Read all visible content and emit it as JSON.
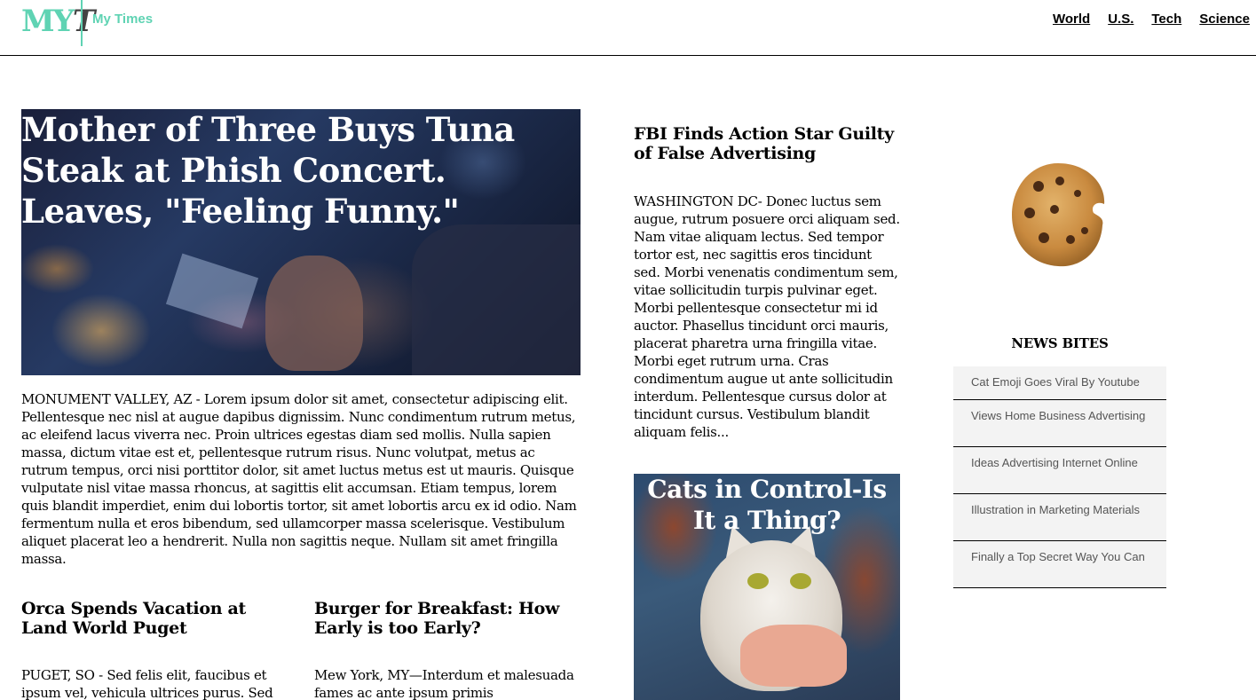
{
  "header": {
    "logo_m": "MY",
    "logo_t": "T",
    "site_name": "My Times",
    "nav": [
      "World",
      "U.S.",
      "Tech",
      "Science"
    ]
  },
  "main_story": {
    "title": "Mother of Three Buys Tuna Steak at Phish Concert. Leaves, \"Feeling Funny.\"",
    "body": "MONUMENT VALLEY, AZ - Lorem ipsum dolor sit amet, consectetur adipiscing elit. Pellentesque nec nisl at augue dapibus dignissim. Nunc condimentum rutrum metus, ac eleifend lacus viverra nec. Proin ultrices egestas diam sed mollis. Nulla sapien massa, dictum vitae est et, pellentesque rutrum risus. Nunc volutpat, metus ac rutrum tempus, orci nisi porttitor dolor, sit amet luctus metus est ut mauris. Quisque vulputate nisl vitae massa rhoncus, at sagittis elit accumsan. Etiam tempus, lorem quis blandit imperdiet, enim dui lobortis tortor, sit amet lobortis arcu ex id odio. Nam fermentum nulla et eros bibendum, sed ullamcorper massa scelerisque. Vestibulum aliquet placerat leo a hendrerit. Nulla non sagittis neque. Nullam sit amet fringilla massa."
  },
  "sub_story_1": {
    "title": "Orca Spends Vacation at Land World Puget",
    "body": "PUGET, SO - Sed felis elit, faucibus et ipsum vel, vehicula ultrices purus. Sed"
  },
  "sub_story_2": {
    "title": "Burger for Breakfast: How Early is too Early?",
    "body": "Mew York, MY—Interdum et malesuada fames ac ante ipsum primis"
  },
  "fbi_story": {
    "title": "FBI Finds Action Star Guilty of False Advertising",
    "body": "WASHINGTON DC- Donec luctus sem augue, rutrum posuere orci aliquam sed. Nam vitae aliquam lectus. Sed tempor tortor est, nec sagittis eros tincidunt sed. Morbi venenatis condimentum sem, vitae sollicitudin turpis pulvinar eget. Morbi pellentesque consectetur mi id auctor. Phasellus tincidunt orci mauris, placerat pharetra urna fringilla vitae. Morbi eget rutrum urna. Cras condimentum augue ut ante sollicitudin interdum. Pellentesque cursus dolor at tincidunt cursus. Vestibulum blandit aliquam felis..."
  },
  "cat_story": {
    "title": "Cats in Control-Is It a Thing?"
  },
  "news_bites": {
    "heading": "NEWS BITES",
    "items": [
      "Cat Emoji Goes Viral By Youtube",
      "Views Home Business Advertising",
      "Ideas Advertising Internet Online",
      "Illustration in Marketing Materials",
      "Finally a Top Secret Way You Can"
    ]
  },
  "colors": {
    "brand": "#5fd3b3",
    "list_bg": "#f3f3f3",
    "list_text": "#555555"
  }
}
